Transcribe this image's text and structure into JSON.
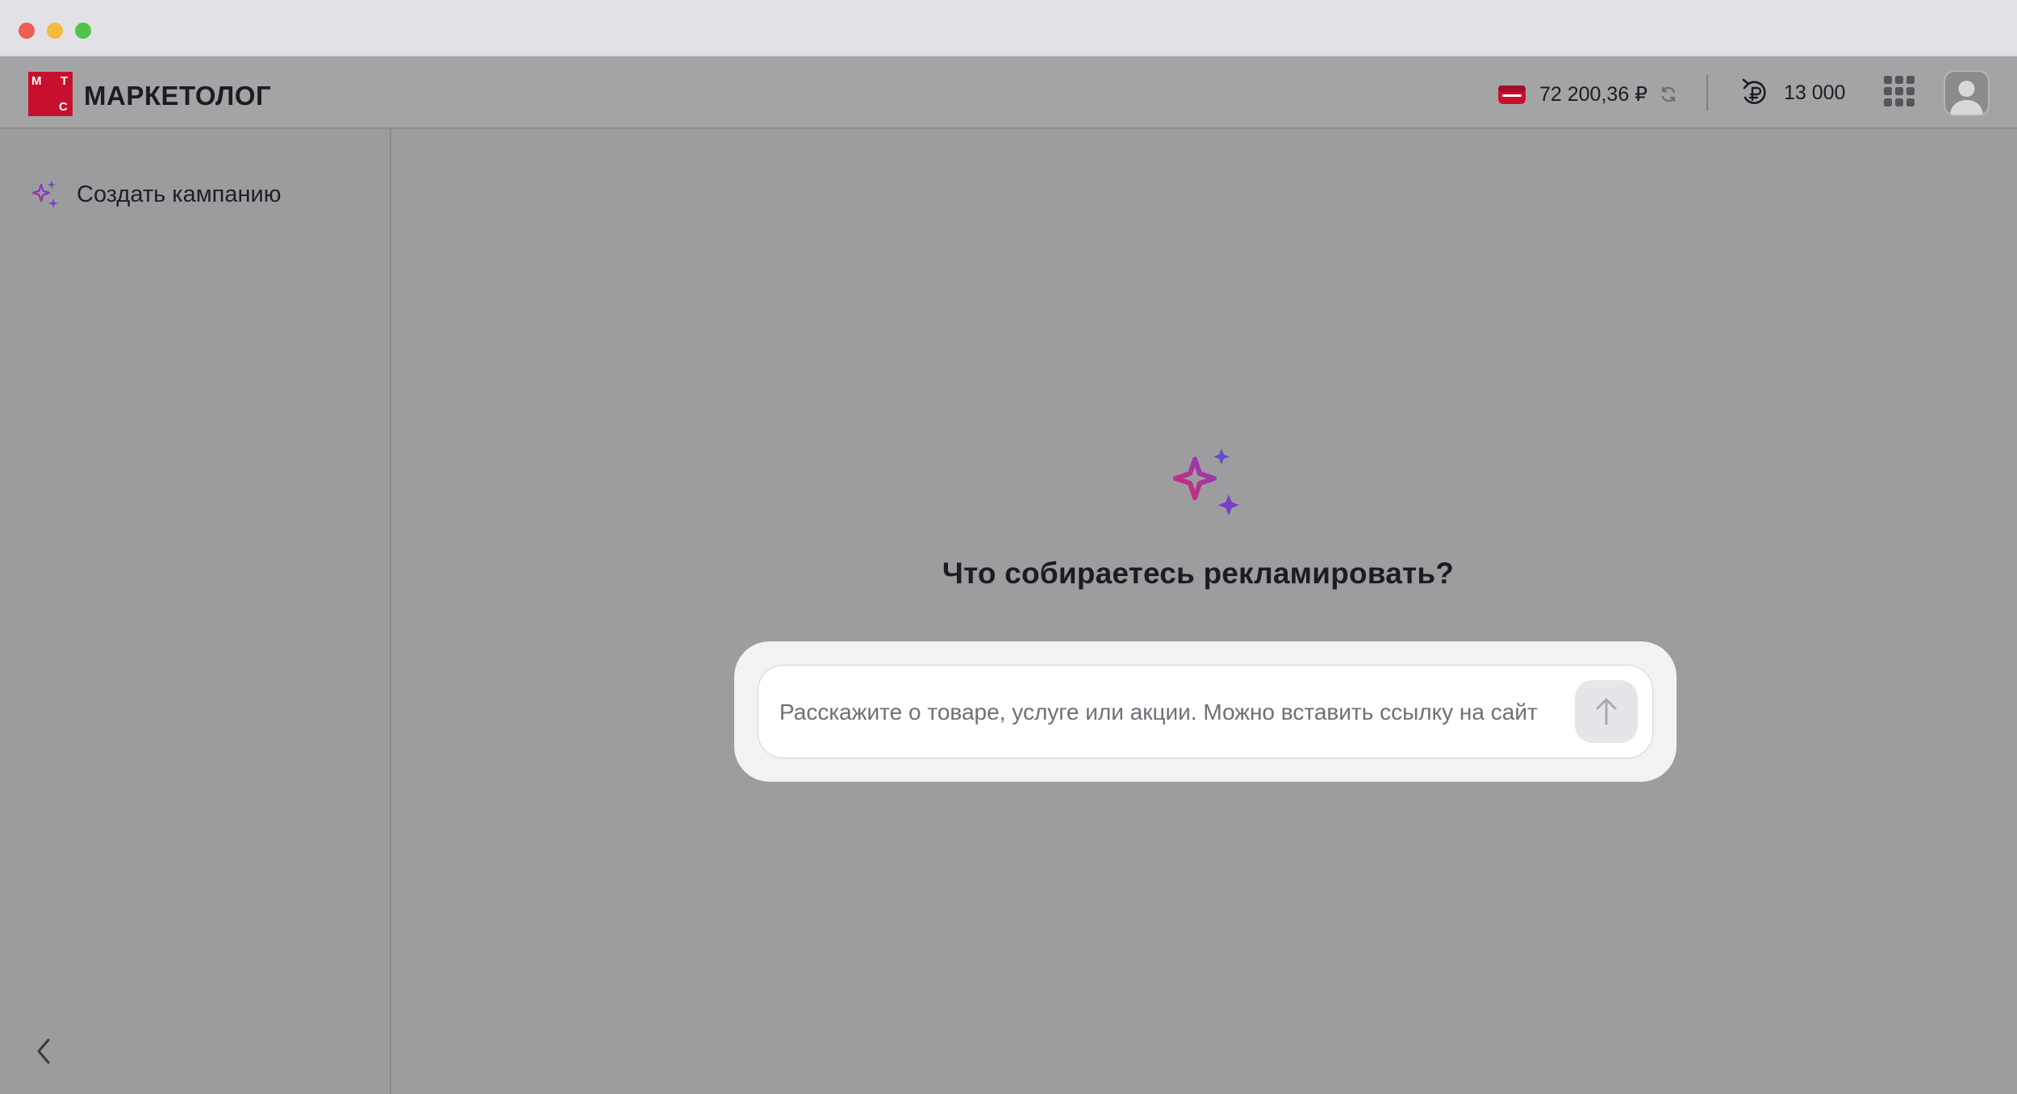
{
  "header": {
    "logo_letters": [
      "М",
      "Т",
      "С"
    ],
    "brand": "МАРКЕТОЛОГ",
    "balance": "72 200,36 ₽",
    "bonus": "13 000"
  },
  "sidebar": {
    "create_campaign": "Создать кампанию"
  },
  "main": {
    "prompt_title": "Что собираетесь рекламировать?",
    "input_placeholder": "Расскажите о товаре, услуге или акции. Можно вставить ссылку на сайт",
    "input_value": ""
  },
  "icons": {
    "logo": "mts-logo-icon",
    "wallet": "wallet-icon",
    "refresh": "refresh-icon",
    "bonus": "bonus-ruble-icon",
    "apps": "apps-grid-icon",
    "avatar": "user-avatar-icon",
    "sparkles": "sparkles-icon",
    "collapse": "chevron-left-icon",
    "send": "arrow-up-icon"
  },
  "colors": {
    "brand_red": "#c8102e",
    "sparkle_pink": "#d4296f",
    "sparkle_purple": "#7a4bd0",
    "overlay_gray": "#9d9da0"
  }
}
